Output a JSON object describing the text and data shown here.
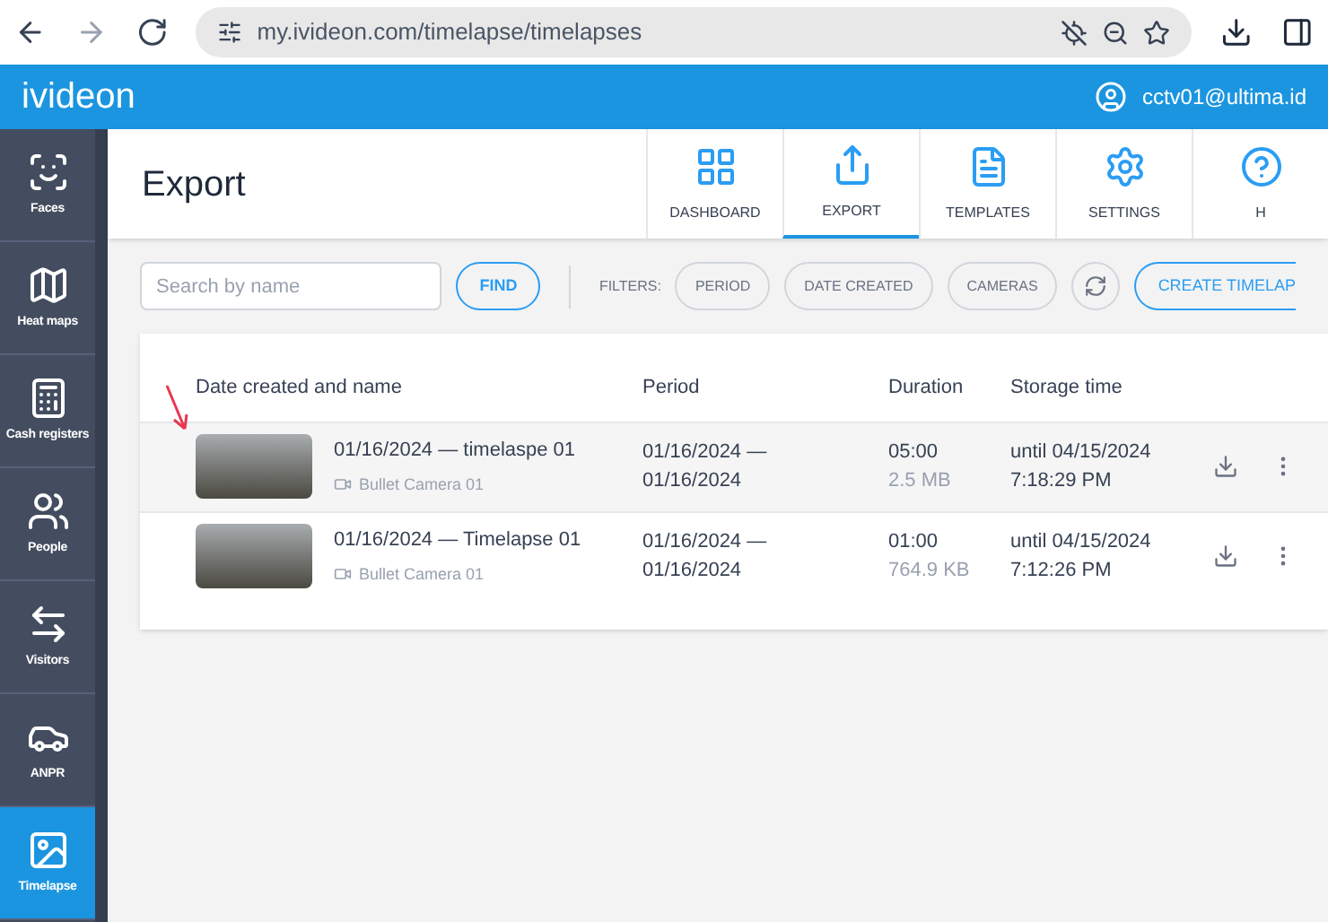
{
  "browser": {
    "url": "my.ivideon.com/timelapse/timelapses"
  },
  "app": {
    "logo": "ivideon",
    "user": "cctv01@ultima.id"
  },
  "sidebar": {
    "items": [
      {
        "label": "Faces",
        "selected": false
      },
      {
        "label": "Heat maps",
        "selected": false
      },
      {
        "label": "Cash registers",
        "selected": false
      },
      {
        "label": "People",
        "selected": false
      },
      {
        "label": "Visitors",
        "selected": false
      },
      {
        "label": "ANPR",
        "selected": false
      },
      {
        "label": "Timelapse",
        "selected": true
      }
    ]
  },
  "page": {
    "title": "Export"
  },
  "tabs": [
    {
      "label": "DASHBOARD",
      "selected": false
    },
    {
      "label": "EXPORT",
      "selected": true
    },
    {
      "label": "TEMPLATES",
      "selected": false
    },
    {
      "label": "SETTINGS",
      "selected": false
    },
    {
      "label": "H",
      "selected": false
    }
  ],
  "search": {
    "placeholder": "Search by name"
  },
  "find_button": "FIND",
  "filters_label": "FILTERS:",
  "filters": [
    "PERIOD",
    "DATE CREATED",
    "CAMERAS"
  ],
  "create_button": "CREATE TIMELAP",
  "table": {
    "columns": [
      "Date created and name",
      "Period",
      "Duration",
      "Storage time"
    ],
    "rows": [
      {
        "name": "01/16/2024 — timelaspe 01",
        "camera": "Bullet Camera 01",
        "period_start": "01/16/2024 —",
        "period_end": "01/16/2024",
        "duration": "05:00",
        "size": "2.5 MB",
        "storage_date": "until 04/15/2024",
        "storage_time": "7:18:29 PM"
      },
      {
        "name": "01/16/2024 — Timelapse 01",
        "camera": "Bullet Camera 01",
        "period_start": "01/16/2024 —",
        "period_end": "01/16/2024",
        "duration": "01:00",
        "size": "764.9 KB",
        "storage_date": "until 04/15/2024",
        "storage_time": "7:12:26 PM"
      }
    ]
  }
}
